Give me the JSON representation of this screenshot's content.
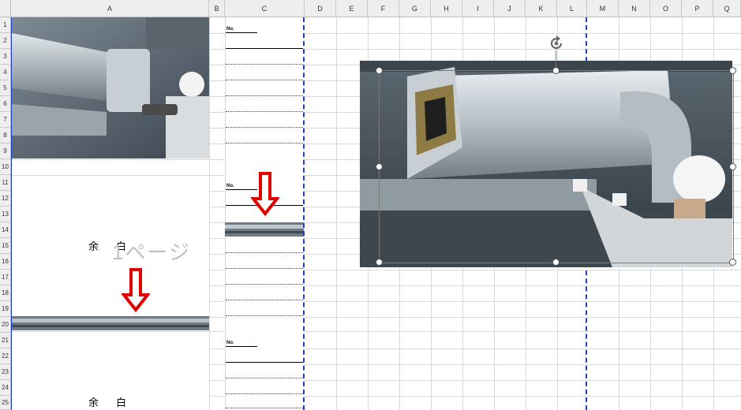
{
  "columns": [
    "A",
    "B",
    "C",
    "D",
    "E",
    "F",
    "G",
    "H",
    "I",
    "J",
    "K",
    "L",
    "M",
    "N",
    "O",
    "P",
    "Q"
  ],
  "rows": [
    "1",
    "2",
    "3",
    "4",
    "5",
    "6",
    "7",
    "8",
    "9",
    "10",
    "11",
    "12",
    "13",
    "14",
    "15",
    "16",
    "17",
    "18",
    "19",
    "20",
    "21",
    "22",
    "23",
    "24",
    "25"
  ],
  "memo_label": "No.",
  "blank_text": "余白",
  "page_watermark": "1ページ",
  "colors": {
    "page_break": "#1f3fbf",
    "arrow": "#e00000",
    "grid": "#d9d9d9",
    "header_bg": "#eeeeee"
  },
  "images": {
    "photo_top_left": "photo-duct-worker-sealing",
    "photo_selected": "photo-duct-worker-inspecting",
    "strip": "photo-duct-strip"
  },
  "icons": {
    "rotate": "rotate-handle-icon",
    "arrow": "down-arrow-icon"
  }
}
